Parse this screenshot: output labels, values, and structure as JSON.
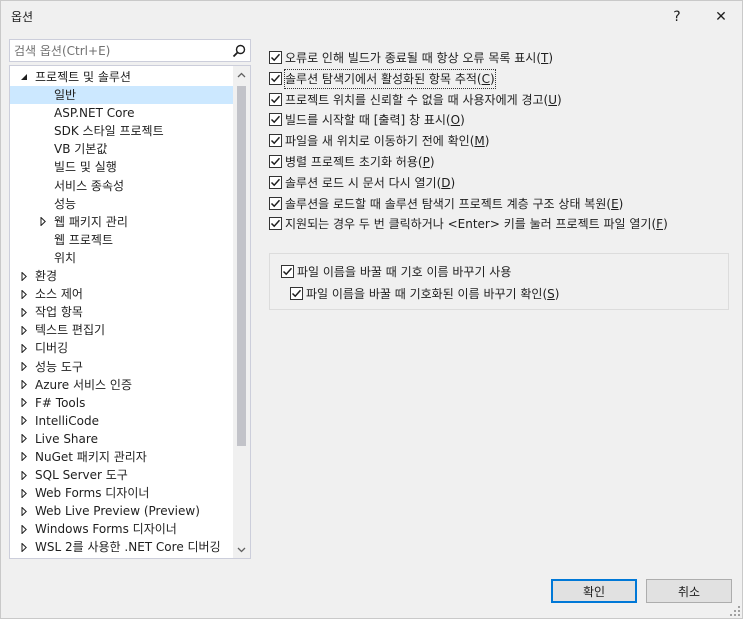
{
  "window": {
    "title": "옵션",
    "help_glyph": "?",
    "close_glyph": "✕"
  },
  "search": {
    "placeholder": "검색 옵션(Ctrl+E)"
  },
  "tree": {
    "items": [
      {
        "label": "프로젝트 및 솔루션",
        "level": 1,
        "arrow": "expanded",
        "selected": false
      },
      {
        "label": "일반",
        "level": 2,
        "arrow": "none",
        "selected": true
      },
      {
        "label": "ASP.NET Core",
        "level": 2,
        "arrow": "none",
        "selected": false
      },
      {
        "label": "SDK 스타일 프로젝트",
        "level": 2,
        "arrow": "none",
        "selected": false
      },
      {
        "label": "VB 기본값",
        "level": 2,
        "arrow": "none",
        "selected": false
      },
      {
        "label": "빌드 및 실행",
        "level": 2,
        "arrow": "none",
        "selected": false
      },
      {
        "label": "서비스 종속성",
        "level": 2,
        "arrow": "none",
        "selected": false
      },
      {
        "label": "성능",
        "level": 2,
        "arrow": "none",
        "selected": false
      },
      {
        "label": "웹 패키지 관리",
        "level": 2,
        "arrow": "collapsed",
        "selected": false
      },
      {
        "label": "웹 프로젝트",
        "level": 2,
        "arrow": "none",
        "selected": false
      },
      {
        "label": "위치",
        "level": 2,
        "arrow": "none",
        "selected": false
      },
      {
        "label": "환경",
        "level": 1,
        "arrow": "collapsed",
        "selected": false
      },
      {
        "label": "소스 제어",
        "level": 1,
        "arrow": "collapsed",
        "selected": false
      },
      {
        "label": "작업 항목",
        "level": 1,
        "arrow": "collapsed",
        "selected": false
      },
      {
        "label": "텍스트 편집기",
        "level": 1,
        "arrow": "collapsed",
        "selected": false
      },
      {
        "label": "디버깅",
        "level": 1,
        "arrow": "collapsed",
        "selected": false
      },
      {
        "label": "성능 도구",
        "level": 1,
        "arrow": "collapsed",
        "selected": false
      },
      {
        "label": "Azure 서비스 인증",
        "level": 1,
        "arrow": "collapsed",
        "selected": false
      },
      {
        "label": "F# Tools",
        "level": 1,
        "arrow": "collapsed",
        "selected": false
      },
      {
        "label": "IntelliCode",
        "level": 1,
        "arrow": "collapsed",
        "selected": false
      },
      {
        "label": "Live Share",
        "level": 1,
        "arrow": "collapsed",
        "selected": false
      },
      {
        "label": "NuGet 패키지 관리자",
        "level": 1,
        "arrow": "collapsed",
        "selected": false
      },
      {
        "label": "SQL Server 도구",
        "level": 1,
        "arrow": "collapsed",
        "selected": false
      },
      {
        "label": "Web Forms 디자이너",
        "level": 1,
        "arrow": "collapsed",
        "selected": false
      },
      {
        "label": "Web Live Preview (Preview)",
        "level": 1,
        "arrow": "collapsed",
        "selected": false
      },
      {
        "label": "Windows Forms 디자이너",
        "level": 1,
        "arrow": "collapsed",
        "selected": false
      },
      {
        "label": "WSL 2를 사용한 .NET Core 디버깅",
        "level": 1,
        "arrow": "collapsed",
        "selected": false
      }
    ]
  },
  "options": [
    {
      "text": "오류로 인해 빌드가 종료될 때 항상 오류 목록 표시",
      "key": "T",
      "checked": true,
      "focused": false
    },
    {
      "text": "솔루션 탐색기에서 활성화된 항목 추적",
      "key": "C",
      "checked": true,
      "focused": true
    },
    {
      "text": "프로젝트 위치를 신뢰할 수 없을 때 사용자에게 경고",
      "key": "U",
      "checked": true,
      "focused": false
    },
    {
      "text": "빌드를 시작할 때 [출력] 창 표시",
      "key": "O",
      "checked": true,
      "focused": false
    },
    {
      "text": "파일을 새 위치로 이동하기 전에 확인",
      "key": "M",
      "checked": true,
      "focused": false
    },
    {
      "text": "병렬 프로젝트 초기화 허용",
      "key": "P",
      "checked": true,
      "focused": false
    },
    {
      "text": "솔루션 로드 시 문서 다시 열기",
      "key": "D",
      "checked": true,
      "focused": false
    },
    {
      "text": "솔루션을 로드할 때 솔루션 탐색기 프로젝트 계층 구조 상태 복원",
      "key": "E",
      "checked": true,
      "focused": false
    },
    {
      "text": "지원되는 경우 두 번 클릭하거나 <Enter> 키를 눌러 프로젝트 파일 열기",
      "key": "F",
      "checked": true,
      "focused": false
    }
  ],
  "rename_group": {
    "rename_symbol": {
      "text": "파일 이름을 바꿀 때 기호 이름 바꾸기 사용",
      "key": "",
      "checked": true
    },
    "confirm_rename": {
      "text": "파일 이름을 바꿀 때 기호화된 이름 바꾸기 확인",
      "key": "S",
      "checked": true
    }
  },
  "buttons": {
    "ok": "확인",
    "cancel": "취소"
  },
  "colors": {
    "selection": "#cce8ff",
    "accent": "#0078d7"
  }
}
